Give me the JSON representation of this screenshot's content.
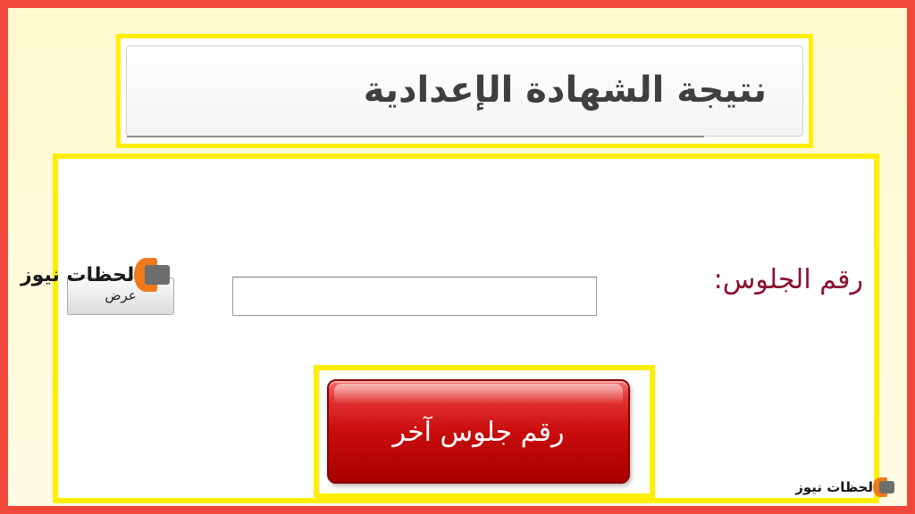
{
  "page": {
    "title": "نتيجة الشهادة الإعدادية"
  },
  "form": {
    "seat_label": "رقم الجلوس:",
    "seat_input_value": "",
    "show_button_label": "عرض"
  },
  "actions": {
    "another_seat_label": "رقم جلوس آخر"
  },
  "watermark": {
    "text": "لحظات نيوز"
  },
  "colors": {
    "outer_border": "#f0473b",
    "highlight_border": "#ffee00",
    "label_color": "#8a1230",
    "button_red": "#c90c0c",
    "logo_orange": "#ef7a1a"
  }
}
